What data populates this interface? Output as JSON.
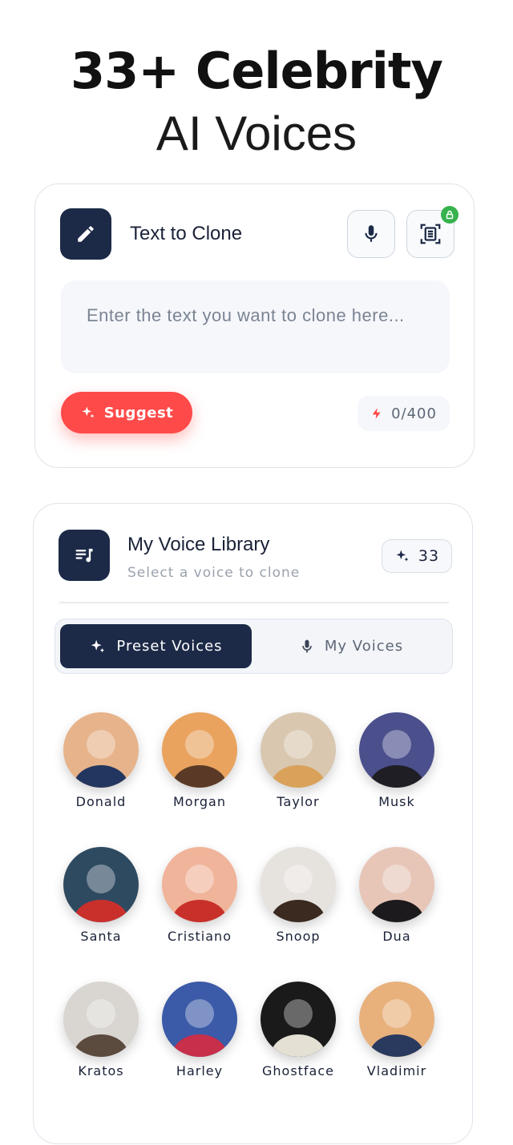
{
  "hero": {
    "line1": "33+ Celebrity",
    "line2": "AI Voices"
  },
  "clone_card": {
    "title": "Text to Clone",
    "placeholder": "Enter the text you want to clone here...",
    "suggest_label": "Suggest",
    "counter": "0/400"
  },
  "library": {
    "title": "My Voice Library",
    "subtitle": "Select a voice to clone",
    "count": "33",
    "tabs": {
      "preset": "Preset Voices",
      "mine": "My Voices"
    },
    "voices": [
      {
        "name": "Donald",
        "bg": "#e7b38a",
        "fg": "#23365f"
      },
      {
        "name": "Morgan",
        "bg": "#e9a35e",
        "fg": "#5a3a26"
      },
      {
        "name": "Taylor",
        "bg": "#d9c7b0",
        "fg": "#d9a15a"
      },
      {
        "name": "Musk",
        "bg": "#4b4f8c",
        "fg": "#1e1e24"
      },
      {
        "name": "Santa",
        "bg": "#2e4a61",
        "fg": "#c9302c"
      },
      {
        "name": "Cristiano",
        "bg": "#f0b49a",
        "fg": "#c8302a"
      },
      {
        "name": "Snoop",
        "bg": "#e6e2de",
        "fg": "#3a2a20"
      },
      {
        "name": "Dua",
        "bg": "#e7c6b8",
        "fg": "#1d1a1d"
      },
      {
        "name": "Kratos",
        "bg": "#d9d6d2",
        "fg": "#5b4a3e"
      },
      {
        "name": "Harley",
        "bg": "#3b5aa8",
        "fg": "#c72f4a"
      },
      {
        "name": "Ghostface",
        "bg": "#1a1a1a",
        "fg": "#e4e0d4"
      },
      {
        "name": "Vladimir",
        "bg": "#e8b17c",
        "fg": "#2a3a5e"
      }
    ]
  },
  "colors": {
    "navy": "#1c2a48",
    "accent_red": "#ff4a4a",
    "lock_green": "#37b24d"
  }
}
